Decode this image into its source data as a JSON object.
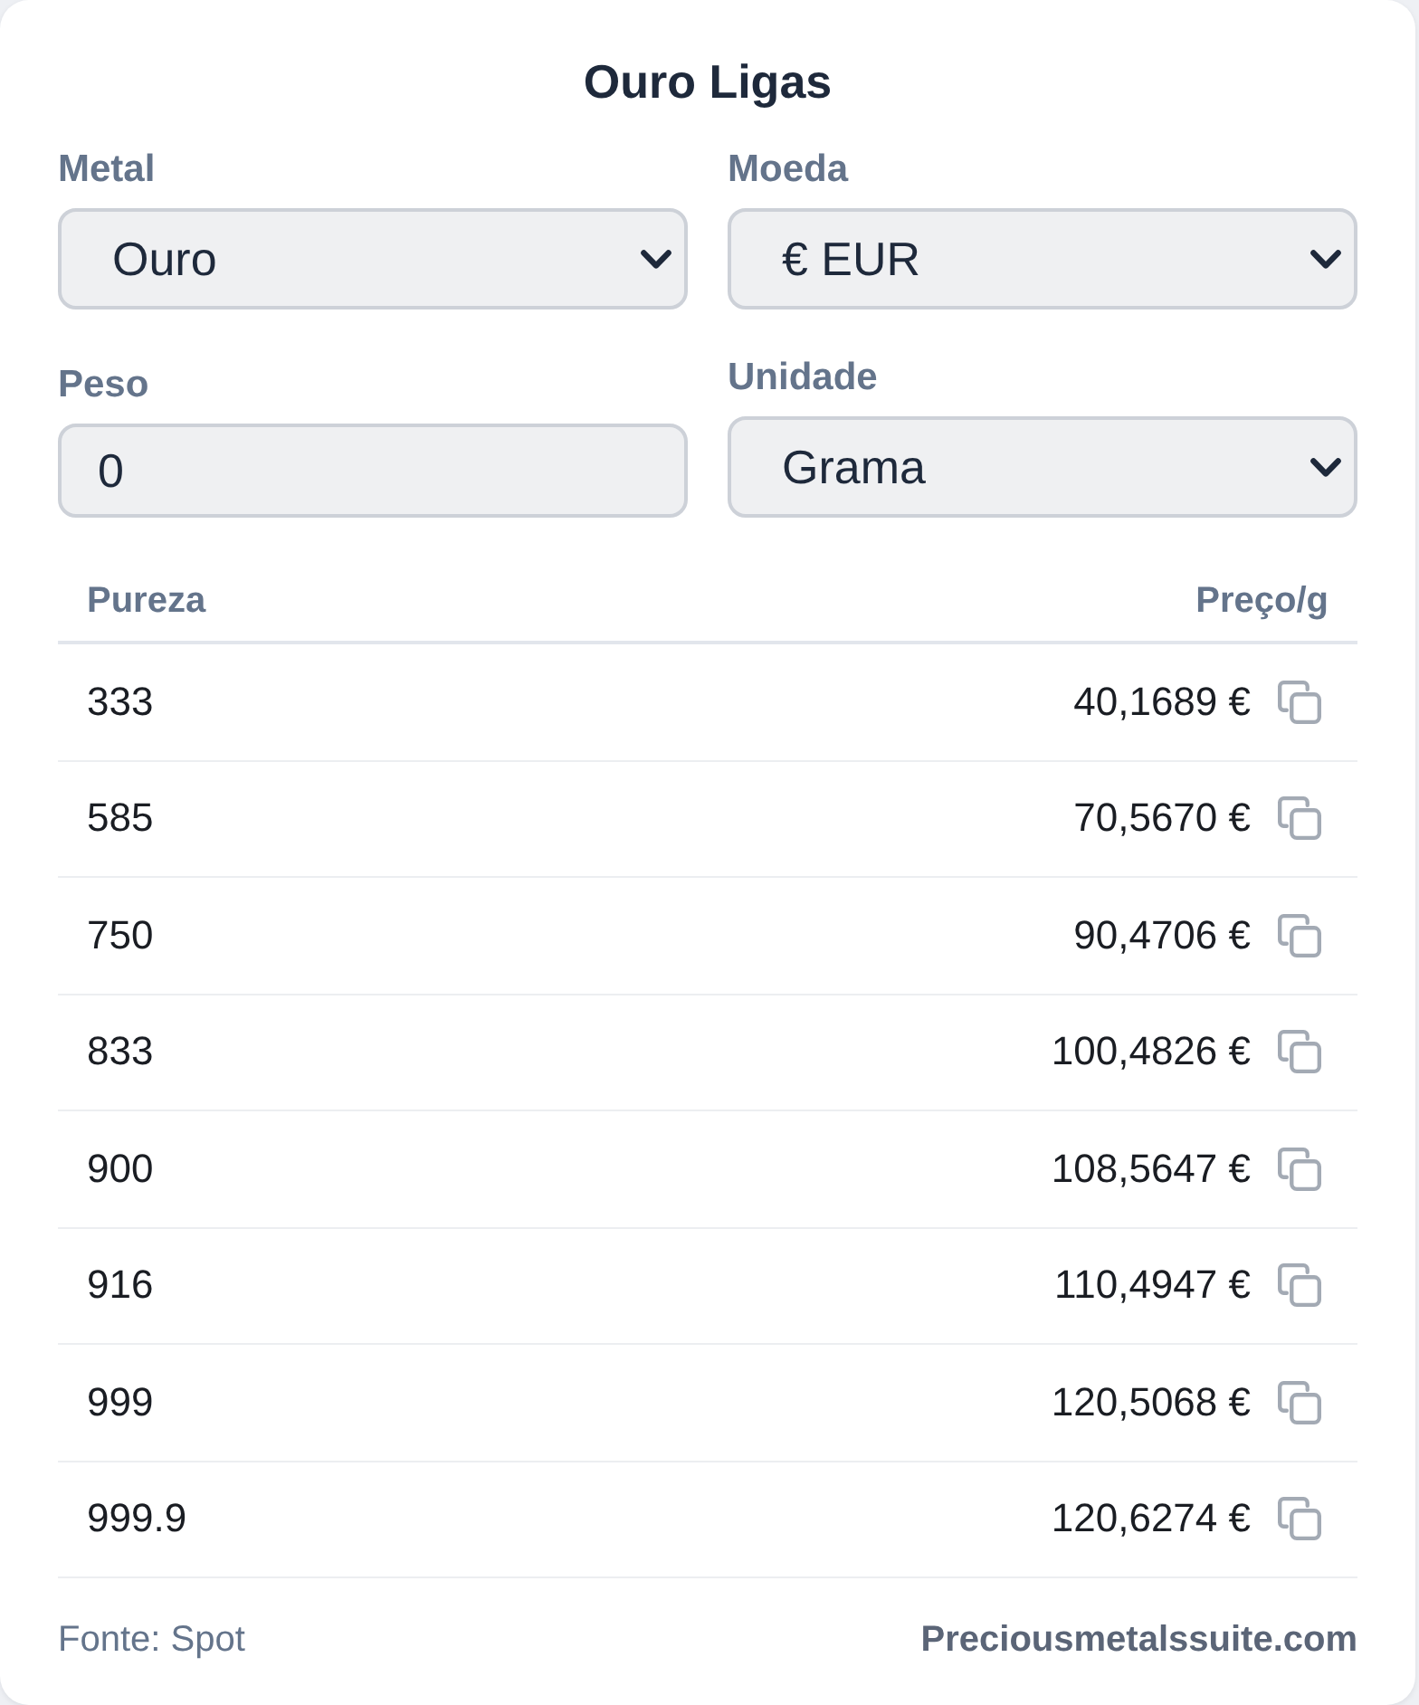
{
  "title": "Ouro Ligas",
  "fields": [
    {
      "kind": "select",
      "label": "Metal",
      "value": "Ouro"
    },
    {
      "kind": "select",
      "label": "Moeda",
      "value": "€ EUR"
    },
    {
      "kind": "input",
      "label": "Peso",
      "value": "0"
    },
    {
      "kind": "select",
      "label": "Unidade",
      "value": "Grama"
    }
  ],
  "table": {
    "columns": [
      "Pureza",
      "Preço/g"
    ],
    "rows": [
      {
        "purity": "333",
        "price": "40,1689 €"
      },
      {
        "purity": "585",
        "price": "70,5670 €"
      },
      {
        "purity": "750",
        "price": "90,4706 €"
      },
      {
        "purity": "833",
        "price": "100,4826 €"
      },
      {
        "purity": "900",
        "price": "108,5647 €"
      },
      {
        "purity": "916",
        "price": "110,4947 €"
      },
      {
        "purity": "999",
        "price": "120,5068 €"
      },
      {
        "purity": "999.9",
        "price": "120,6274 €"
      }
    ]
  },
  "footer": {
    "source": "Fonte: Spot",
    "link": "Preciousmetalssuite.com"
  }
}
